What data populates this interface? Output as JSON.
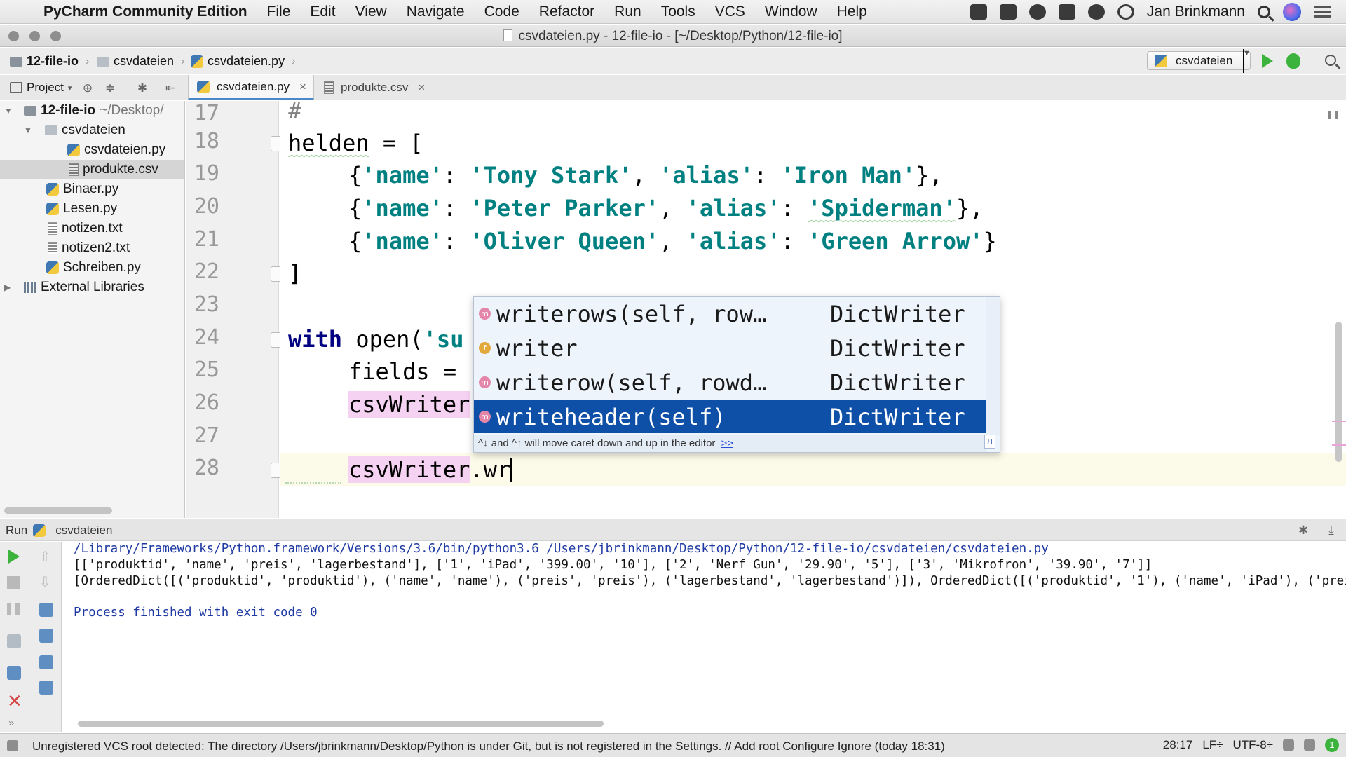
{
  "menubar": {
    "app_name": "PyCharm Community Edition",
    "items": [
      "File",
      "Edit",
      "View",
      "Navigate",
      "Code",
      "Refactor",
      "Run",
      "Tools",
      "VCS",
      "Window",
      "Help"
    ],
    "username": "Jan Brinkmann"
  },
  "window": {
    "title": "csvdateien.py - 12-file-io - [~/Desktop/Python/12-file-io]"
  },
  "breadcrumb": [
    "12-file-io",
    "csvdateien",
    "csvdateien.py"
  ],
  "run_config": {
    "label": "csvdateien"
  },
  "toolstrip": {
    "project_label": "Project"
  },
  "tabs": [
    {
      "label": "csvdateien.py",
      "active": true
    },
    {
      "label": "produkte.csv",
      "active": false
    }
  ],
  "project_tree": {
    "root": {
      "name": "12-file-io",
      "path": "~/Desktop/"
    },
    "folder": "csvdateien",
    "items": [
      "csvdateien.py",
      "produkte.csv",
      "Binaer.py",
      "Lesen.py",
      "notizen.txt",
      "notizen2.txt",
      "Schreiben.py"
    ],
    "external": "External Libraries"
  },
  "editor": {
    "line_numbers": [
      "17",
      "18",
      "19",
      "20",
      "21",
      "22",
      "23",
      "24",
      "25",
      "26",
      "27",
      "28"
    ],
    "code": {
      "l17": "#",
      "l18_var": "helden",
      "l18_rest": " = [",
      "l19": [
        "{",
        "'name'",
        ": ",
        "'Tony Stark'",
        ", ",
        "'alias'",
        ": ",
        "'Iron Man'",
        "},"
      ],
      "l20": [
        "{",
        "'name'",
        ": ",
        "'Peter Parker'",
        ", ",
        "'alias'",
        ": ",
        "'Spiderman'",
        "},"
      ],
      "l21": [
        "{",
        "'name'",
        ": ",
        "'Oliver Queen'",
        ", ",
        "'alias'",
        ": ",
        "'Green Arrow'",
        "}"
      ],
      "l22": "]",
      "l24_kw": "with",
      "l24_rest": " open(",
      "l24_str": "'su",
      "l25": "fields = ",
      "l26": "csvWriter",
      "l28_var": "csvWriter",
      "l28_rest": ".wr"
    }
  },
  "completion": {
    "items": [
      {
        "badge": "m",
        "name": "writerows(self, row…",
        "type": "DictWriter",
        "selected": false
      },
      {
        "badge": "f",
        "name": "writer",
        "type": "DictWriter",
        "selected": false
      },
      {
        "badge": "m",
        "name": "writerow(self, rowd…",
        "type": "DictWriter",
        "selected": false
      },
      {
        "badge": "m",
        "name": "writeheader(self)",
        "type": "DictWriter",
        "selected": true
      }
    ],
    "hint": "^↓ and ^↑ will move caret down and up in the editor",
    "hint_link": ">>",
    "pi": "π"
  },
  "run_panel": {
    "title": "Run",
    "config": "csvdateien",
    "lines": [
      "/Library/Frameworks/Python.framework/Versions/3.6/bin/python3.6 /Users/jbrinkmann/Desktop/Python/12-file-io/csvdateien/csvdateien.py",
      "[['produktid', 'name', 'preis', 'lagerbestand'], ['1', 'iPad', '399.00', '10'], ['2', 'Nerf Gun', '29.90', '5'], ['3', 'Mikrofron', '39.90', '7']]",
      "[OrderedDict([('produktid', 'produktid'), ('name', 'name'), ('preis', 'preis'), ('lagerbestand', 'lagerbestand')]), OrderedDict([('produktid', '1'), ('name', 'iPad'), ('prei",
      "Process finished with exit code 0"
    ]
  },
  "statusbar": {
    "message": "Unregistered VCS root detected: The directory /Users/jbrinkmann/Desktop/Python is under Git, but is not registered in the Settings. // Add root  Configure  Ignore (today 18:31)",
    "position": "28:17",
    "line_sep": "LF÷",
    "encoding": "UTF-8÷",
    "badge": "1"
  }
}
